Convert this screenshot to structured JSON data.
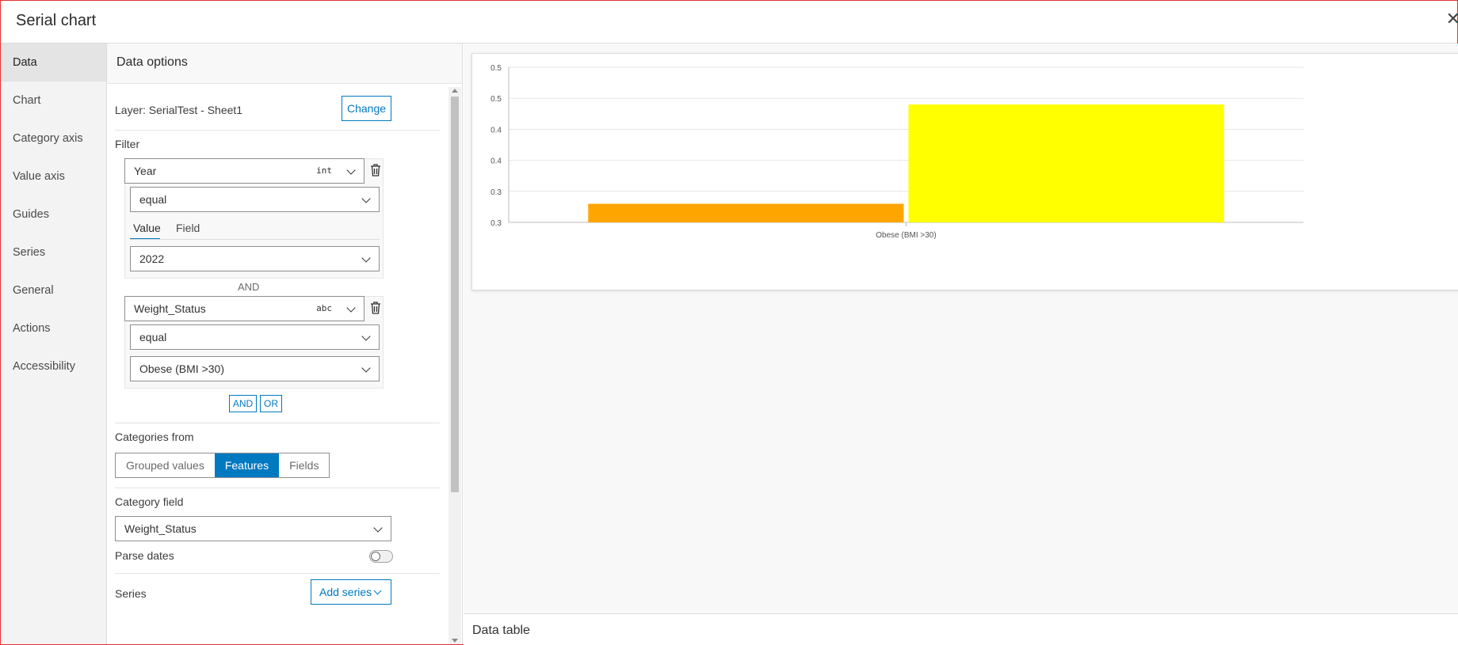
{
  "window": {
    "title": "Serial chart",
    "close_label": "✕"
  },
  "nav": {
    "items": [
      {
        "label": "Data",
        "active": true
      },
      {
        "label": "Chart"
      },
      {
        "label": "Category axis"
      },
      {
        "label": "Value axis"
      },
      {
        "label": "Guides"
      },
      {
        "label": "Series"
      },
      {
        "label": "General"
      },
      {
        "label": "Actions"
      },
      {
        "label": "Accessibility"
      }
    ]
  },
  "data_options": {
    "title": "Data options",
    "layer_label": "Layer: SerialTest - Sheet1",
    "change_button": "Change",
    "filter_label": "Filter",
    "filters": [
      {
        "field": "Year",
        "type_tag": "int",
        "operator": "equal",
        "tabs": [
          "Value",
          "Field"
        ],
        "active_tab": "Value",
        "value": "2022"
      },
      {
        "field": "Weight_Status",
        "type_tag": "abc",
        "operator": "equal",
        "value": "Obese (BMI >30)"
      }
    ],
    "join_label": "AND",
    "add_and_button": "AND",
    "add_or_button": "OR",
    "categories_from": {
      "label": "Categories from",
      "options": [
        "Grouped values",
        "Features",
        "Fields"
      ],
      "selected": "Features"
    },
    "category_field": {
      "label": "Category field",
      "value": "Weight_Status"
    },
    "parse_dates": {
      "label": "Parse dates",
      "enabled": false
    },
    "series": {
      "label": "Series",
      "add_button": "Add series"
    }
  },
  "preview": {
    "data_table_label": "Data table"
  },
  "chart_data": {
    "type": "bar",
    "categories": [
      "Obese (BMI >30)"
    ],
    "series": [
      {
        "values": [
          0.28
        ],
        "color": "#FFA500"
      },
      {
        "values": [
          0.44
        ],
        "color": "#FFFF00"
      }
    ],
    "y_tick_labels": [
      "0.3",
      "0.3",
      "0.4",
      "0.4",
      "0.5",
      "0.5"
    ],
    "ylim": [
      0.25,
      0.5
    ],
    "grid": true
  },
  "colors": {
    "accent": "#0079c1",
    "frame_border": "#e63232"
  }
}
